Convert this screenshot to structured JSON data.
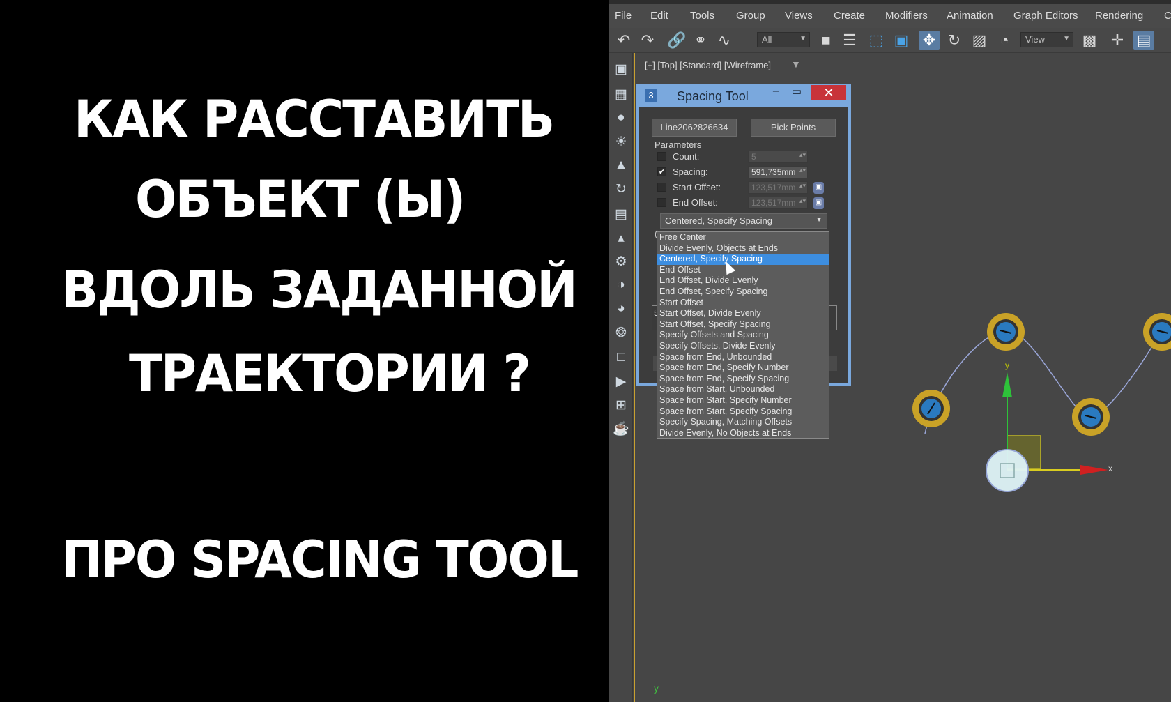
{
  "headline": {
    "line1": "КАК РАССТАВИТЬ",
    "line2": "ОБЪЕКТ (Ы)",
    "line3": "ВДОЛЬ ЗАДАННОЙ",
    "line4": "ТРАЕКТОРИИ ?",
    "line5": "ПРО SPACING TOOL"
  },
  "menu": [
    "File",
    "Edit",
    "Tools",
    "Group",
    "Views",
    "Create",
    "Modifiers",
    "Animation",
    "Graph Editors",
    "Rendering",
    "C"
  ],
  "toolbar": {
    "selection_filter": "All",
    "reference_coord": "View",
    "icons": [
      "undo-icon",
      "redo-icon",
      "link-icon",
      "unlink-icon",
      "bind-space-warp-icon",
      "select-object-icon",
      "select-by-name-icon",
      "rect-selection-icon",
      "window-crossing-icon",
      "move-icon",
      "rotate-icon",
      "scale-icon",
      "place-icon",
      "pivot-icon",
      "snap-move-icon",
      "snap-toggle-icon"
    ]
  },
  "viewport": {
    "label": "[+] [Top] [Standard] [Wireframe]",
    "axis_x": "x",
    "axis_y": "y",
    "bottom_axis": "y"
  },
  "dialog": {
    "title": "Spacing Tool",
    "path_button": "Line2062826634",
    "pick_points_button": "Pick Points",
    "parameters_label": "Parameters",
    "count": {
      "label": "Count:",
      "value": "5",
      "checked": false
    },
    "spacing": {
      "label": "Spacing:",
      "value": "591,735mm",
      "checked": true
    },
    "start_offset": {
      "label": "Start Offset:",
      "value": "123,517mm",
      "checked": false
    },
    "end_offset": {
      "label": "End Offset:",
      "value": "123,517mm",
      "checked": false
    },
    "mode_selected": "Centered, Specify Spacing",
    "hidden_field_text": "5",
    "hidden_left_char": "("
  },
  "dropdown": {
    "selected_index": 2,
    "options": [
      "Free Center",
      "Divide Evenly, Objects at Ends",
      "Centered, Specify Spacing",
      "End Offset",
      "End Offset, Divide Evenly",
      "End Offset, Specify Spacing",
      "Start Offset",
      "Start Offset, Divide Evenly",
      "Start Offset, Specify Spacing",
      "Specify Offsets and Spacing",
      "Specify Offsets, Divide Evenly",
      "Space from End, Unbounded",
      "Space from End, Specify Number",
      "Space from End, Specify Spacing",
      "Space from Start, Unbounded",
      "Space from Start, Specify Number",
      "Space from Start, Specify Spacing",
      "Specify Spacing, Matching Offsets",
      "Divide Evenly, No Objects at Ends"
    ]
  },
  "colors": {
    "accent_blue": "#3d8ee0",
    "dialog_frame": "#7aa8dd",
    "close_red": "#c8333a",
    "ring_gold": "#c9a227",
    "viewport_bg": "#464646"
  }
}
